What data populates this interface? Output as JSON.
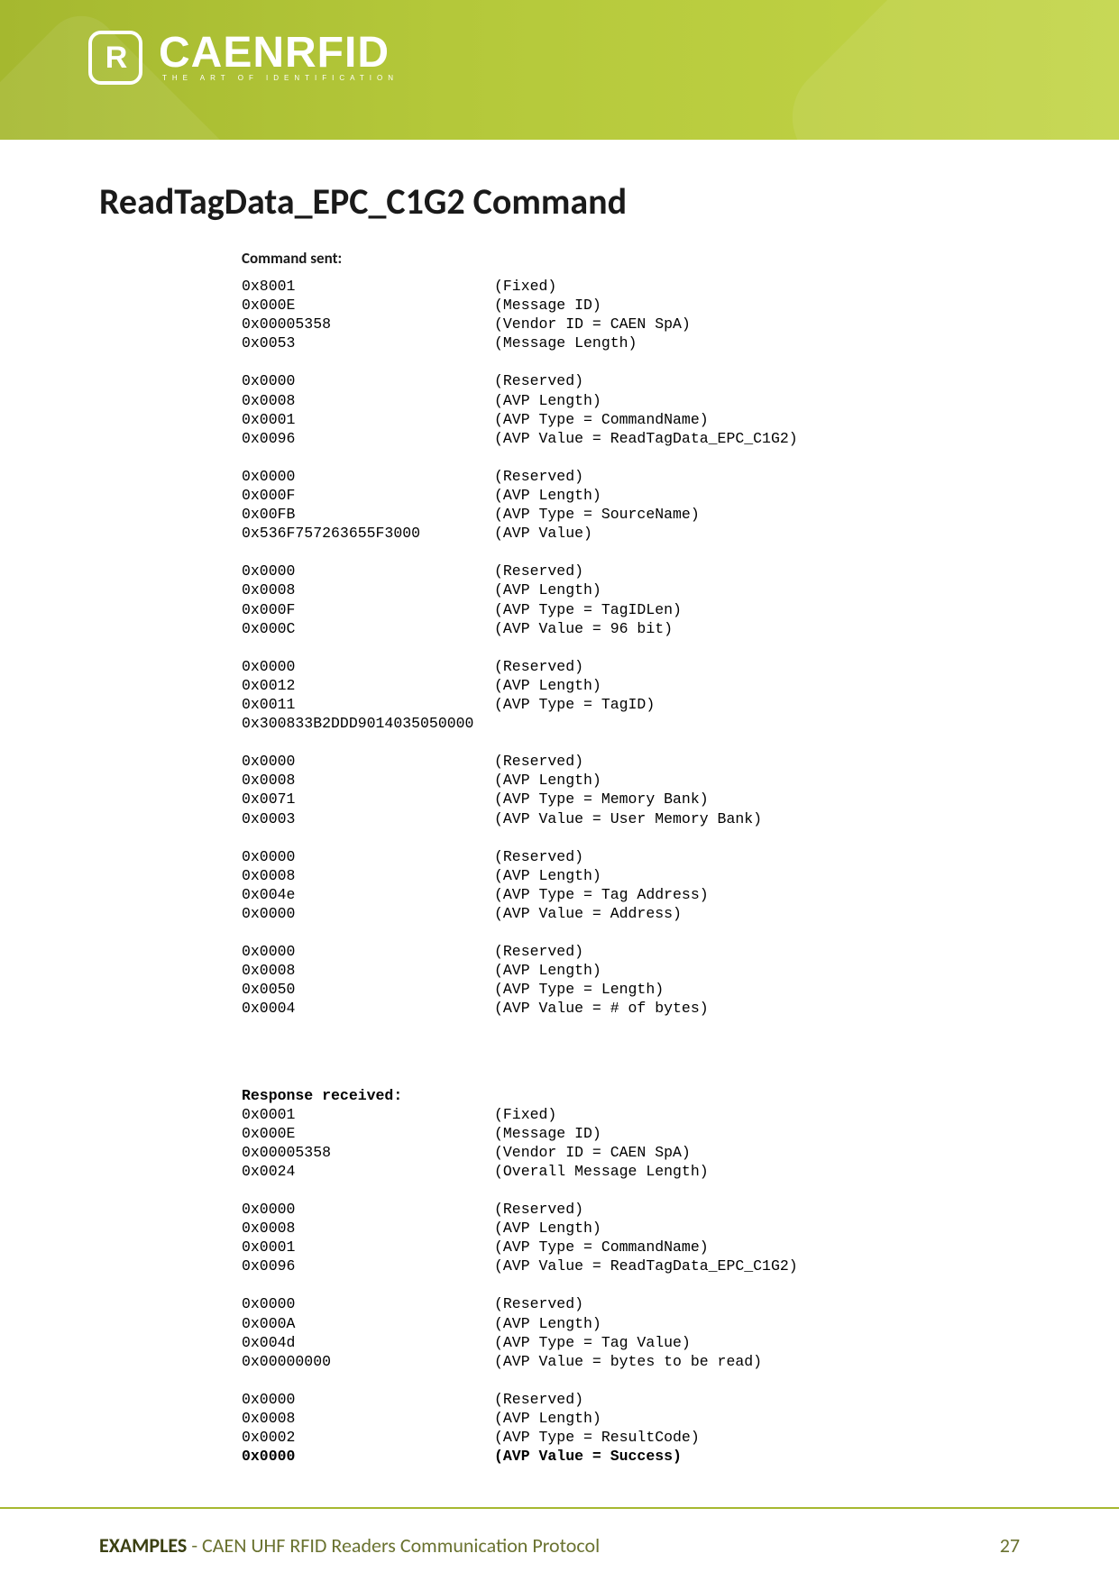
{
  "logo": {
    "badge_letter": "R",
    "brand": "CAENRFID",
    "tagline": "THE ART OF IDENTIFICATION"
  },
  "title": "ReadTagData_EPC_C1G2 Command",
  "command_sent_label": "Command sent:",
  "response_received_label": "Response received:",
  "command_groups": [
    [
      {
        "hex": "0x8001",
        "desc": "(Fixed)"
      },
      {
        "hex": "0x000E",
        "desc": "(Message ID)"
      },
      {
        "hex": "0x00005358",
        "desc": "(Vendor ID = CAEN SpA)"
      },
      {
        "hex": "0x0053",
        "desc": "(Message Length)"
      }
    ],
    [
      {
        "hex": "0x0000",
        "desc": "(Reserved)"
      },
      {
        "hex": "0x0008",
        "desc": "(AVP Length)"
      },
      {
        "hex": "0x0001",
        "desc": "(AVP Type = CommandName)"
      },
      {
        "hex": "0x0096",
        "desc": "(AVP Value = ReadTagData_EPC_C1G2)"
      }
    ],
    [
      {
        "hex": "0x0000",
        "desc": "(Reserved)"
      },
      {
        "hex": "0x000F",
        "desc": "(AVP Length)"
      },
      {
        "hex": "0x00FB",
        "desc": "(AVP Type = SourceName)"
      },
      {
        "hex": "0x536F757263655F3000",
        "desc": "(AVP Value)"
      }
    ],
    [
      {
        "hex": "0x0000",
        "desc": "(Reserved)"
      },
      {
        "hex": "0x0008",
        "desc": "(AVP Length)"
      },
      {
        "hex": "0x000F",
        "desc": "(AVP Type = TagIDLen)"
      },
      {
        "hex": "0x000C",
        "desc": "(AVP Value = 96 bit)"
      }
    ],
    [
      {
        "hex": "0x0000",
        "desc": "(Reserved)"
      },
      {
        "hex": "0x0012",
        "desc": "(AVP Length)"
      },
      {
        "hex": "0x0011",
        "desc": "(AVP Type = TagID)"
      },
      {
        "hex": "0x300833B2DDD9014035050000",
        "desc": ""
      }
    ],
    [
      {
        "hex": "0x0000",
        "desc": "(Reserved)"
      },
      {
        "hex": "0x0008",
        "desc": "(AVP Length)"
      },
      {
        "hex": "0x0071",
        "desc": "(AVP Type = Memory Bank)"
      },
      {
        "hex": "0x0003",
        "desc": "(AVP Value = User Memory Bank)"
      }
    ],
    [
      {
        "hex": "0x0000",
        "desc": "(Reserved)"
      },
      {
        "hex": "0x0008",
        "desc": "(AVP Length)"
      },
      {
        "hex": "0x004e",
        "desc": "(AVP Type = Tag Address)"
      },
      {
        "hex": "0x0000",
        "desc": "(AVP Value = Address)"
      }
    ],
    [
      {
        "hex": "0x0000",
        "desc": "(Reserved)"
      },
      {
        "hex": "0x0008",
        "desc": "(AVP Length)"
      },
      {
        "hex": "0x0050",
        "desc": "(AVP Type = Length)"
      },
      {
        "hex": "0x0004",
        "desc": "(AVP Value = # of bytes)"
      }
    ]
  ],
  "response_groups": [
    [
      {
        "hex": "0x0001",
        "desc": "(Fixed)"
      },
      {
        "hex": "0x000E",
        "desc": "(Message ID)"
      },
      {
        "hex": "0x00005358",
        "desc": "(Vendor ID = CAEN SpA)"
      },
      {
        "hex": "0x0024",
        "desc": "(Overall Message Length)"
      }
    ],
    [
      {
        "hex": "0x0000",
        "desc": "(Reserved)"
      },
      {
        "hex": "0x0008",
        "desc": "(AVP Length)"
      },
      {
        "hex": "0x0001",
        "desc": "(AVP Type = CommandName)"
      },
      {
        "hex": "0x0096",
        "desc": "(AVP Value = ReadTagData_EPC_C1G2)"
      }
    ],
    [
      {
        "hex": "0x0000",
        "desc": "(Reserved)"
      },
      {
        "hex": "0x000A",
        "desc": "(AVP Length)"
      },
      {
        "hex": "0x004d",
        "desc": "(AVP Type = Tag Value)"
      },
      {
        "hex": "0x00000000",
        "desc": "(AVP Value = bytes to be read)"
      }
    ],
    [
      {
        "hex": "0x0000",
        "desc": "(Reserved)"
      },
      {
        "hex": "0x0008",
        "desc": "(AVP Length)"
      },
      {
        "hex": "0x0002",
        "desc": "(AVP Type = ResultCode)"
      },
      {
        "hex": "0x0000",
        "desc": "(AVP Value = Success)",
        "bold": true
      }
    ]
  ],
  "footer": {
    "section": "EXAMPLES",
    "sep": " - ",
    "doc": "CAEN UHF RFID Readers Communication Protocol",
    "page": "27"
  }
}
